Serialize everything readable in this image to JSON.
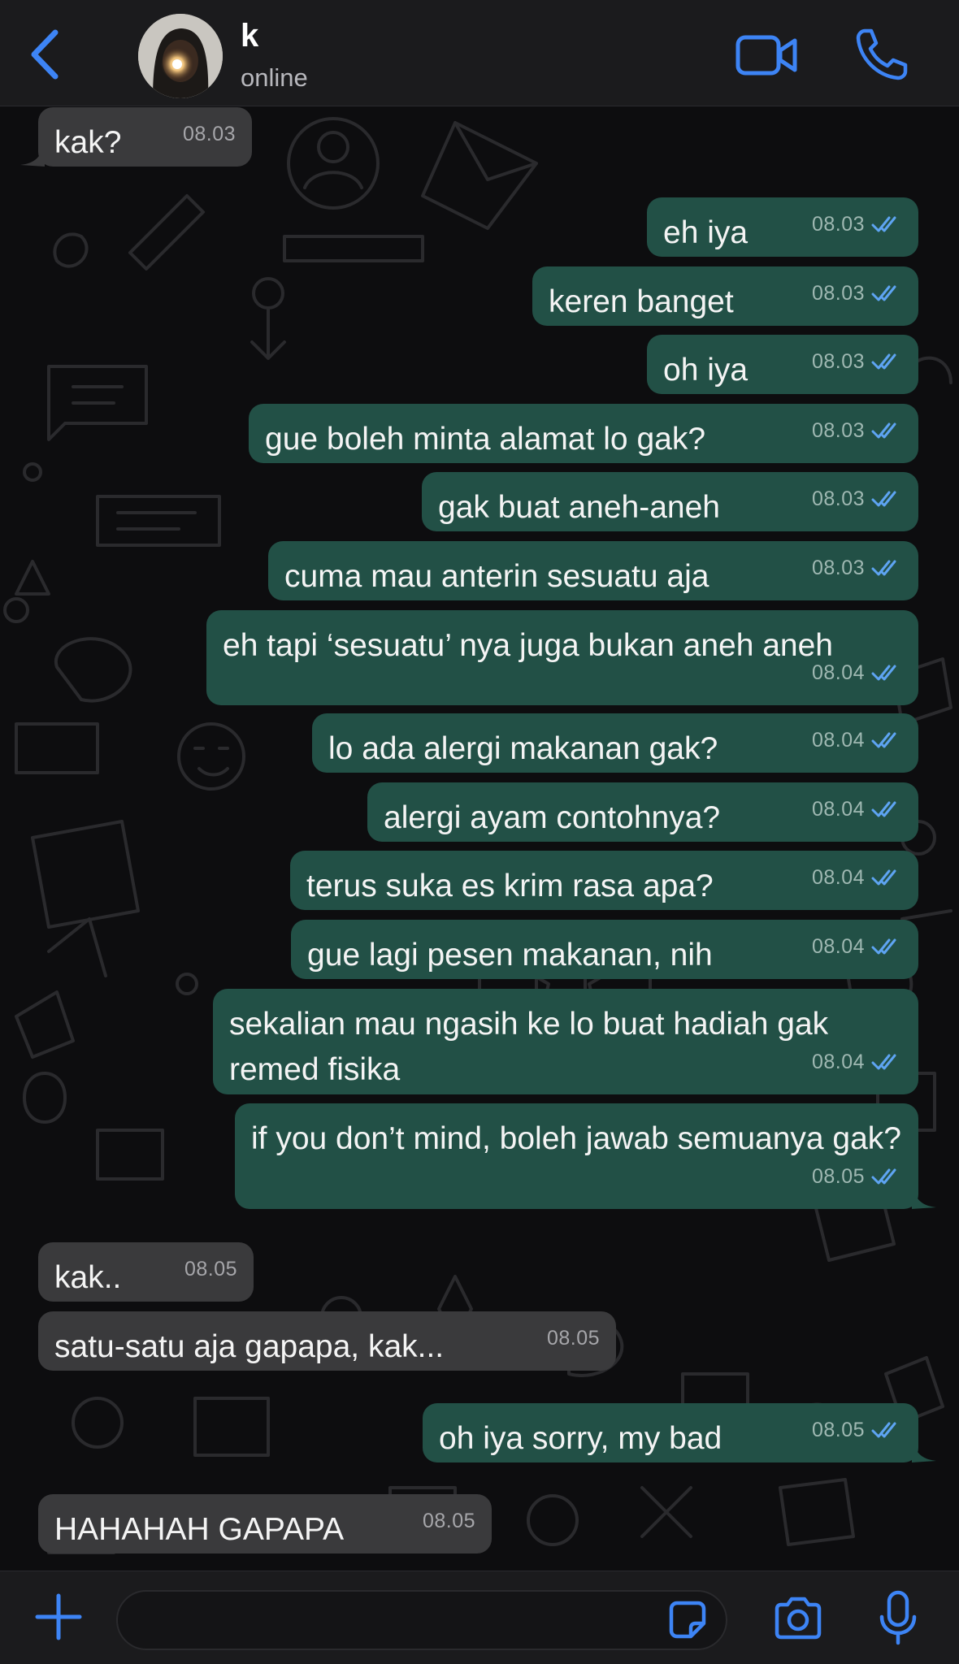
{
  "header": {
    "contact_name": "k",
    "contact_status": "online",
    "back_icon": "chevron-left-icon",
    "video_icon": "video-camera-icon",
    "call_icon": "phone-icon"
  },
  "colors": {
    "accent": "#3d84f5",
    "outgoing_bubble": "#225046",
    "incoming_bubble": "#3a3a3c",
    "read_ticks": "#5ea4f2"
  },
  "messages": [
    {
      "direction": "in",
      "text": "kak?",
      "time": "08.03"
    },
    {
      "direction": "out",
      "text": "eh iya",
      "time": "08.03",
      "status": "read"
    },
    {
      "direction": "out",
      "text": "keren banget",
      "time": "08.03",
      "status": "read"
    },
    {
      "direction": "out",
      "text": "oh iya",
      "time": "08.03",
      "status": "read"
    },
    {
      "direction": "out",
      "text": "gue boleh minta alamat lo gak?",
      "time": "08.03",
      "status": "read"
    },
    {
      "direction": "out",
      "text": "gak buat aneh-aneh",
      "time": "08.03",
      "status": "read"
    },
    {
      "direction": "out",
      "text": "cuma mau anterin sesuatu aja",
      "time": "08.03",
      "status": "read"
    },
    {
      "direction": "out",
      "text": "eh tapi ‘sesuatu’ nya juga bukan aneh aneh",
      "time": "08.04",
      "status": "read"
    },
    {
      "direction": "out",
      "text": "lo ada alergi makanan gak?",
      "time": "08.04",
      "status": "read"
    },
    {
      "direction": "out",
      "text": "alergi ayam contohnya?",
      "time": "08.04",
      "status": "read"
    },
    {
      "direction": "out",
      "text": "terus suka es krim rasa apa?",
      "time": "08.04",
      "status": "read"
    },
    {
      "direction": "out",
      "text": "gue lagi pesen makanan, nih",
      "time": "08.04",
      "status": "read"
    },
    {
      "direction": "out",
      "text": "sekalian mau ngasih ke lo buat hadiah gak remed fisika",
      "time": "08.04",
      "status": "read"
    },
    {
      "direction": "out",
      "text": "if you don’t mind, boleh jawab semuanya gak?",
      "time": "08.05",
      "status": "read"
    },
    {
      "direction": "in",
      "text": "kak..",
      "time": "08.05"
    },
    {
      "direction": "in",
      "text": "satu-satu aja gapapa, kak...",
      "time": "08.05"
    },
    {
      "direction": "out",
      "text": "oh iya sorry, my bad",
      "time": "08.05",
      "status": "read"
    },
    {
      "direction": "in",
      "text": "HAHAHAH GAPAPA",
      "time": "08.05"
    }
  ],
  "composer": {
    "value": "",
    "plus_icon": "plus-icon",
    "sticker_icon": "sticker-icon",
    "camera_icon": "camera-icon",
    "mic_icon": "microphone-icon"
  }
}
